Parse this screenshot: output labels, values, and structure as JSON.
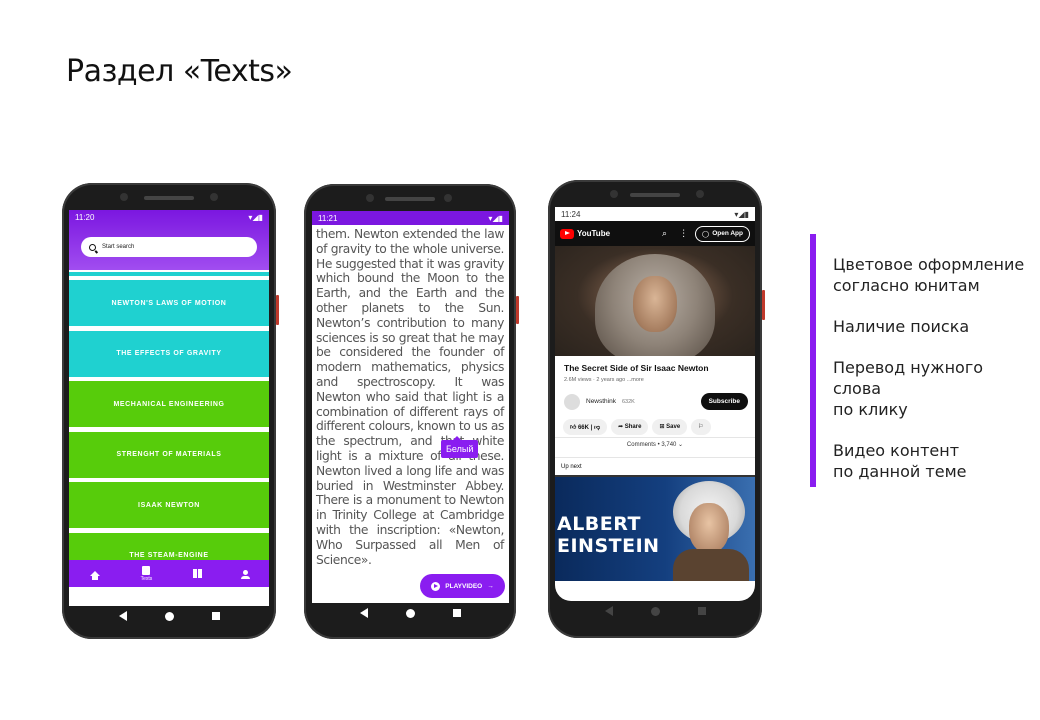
{
  "slide": {
    "title": "Раздел «Texts»"
  },
  "phone1": {
    "status_time": "11:20",
    "search_placeholder": "Start search",
    "topics": [
      {
        "label": "NEWTON'S LAWS OF MOTION",
        "color": "#1fd1d0"
      },
      {
        "label": "THE EFFECTS OF GRAVITY",
        "color": "#1fd1d0"
      },
      {
        "label": "MECHANICAL ENGINEERING",
        "color": "#57cc0b"
      },
      {
        "label": "STRENGHT OF MATERIALS",
        "color": "#57cc0b"
      },
      {
        "label": "ISAAK NEWTON",
        "color": "#57cc0b"
      },
      {
        "label": "THE STEAM-ENGINE",
        "color": "#57cc0b"
      }
    ],
    "bottom_nav": {
      "texts_label": "Texts"
    },
    "accent": "#8a1df0"
  },
  "phone2": {
    "status_time": "11:21",
    "reading_text": "them. Newton extended the law of gravity to the whole universe. He suggested that it was gravity which bound the Moon to the Earth, and the Earth and the other planets to the Sun. Newton’s contribution to many sciences is so great that he may be considered the founder of modern mathematics, physics and spectroscopy. It was Newton who said that light is a combination of different rays of different colours, known to us as the spectrum, and that white light is a mixture of all these. Newton lived a long life and was buried in Westminster Abbey. There is a monument to Newton in Trinity College at Cambridge with the inscription: «Newton, Who Surpassed all Men of Science».",
    "tooltip": "Белый",
    "play_button": "PLAYVIDEO"
  },
  "phone3": {
    "status_time": "11:24",
    "brand": "YouTube",
    "open_app": "Open App",
    "video_title": "The Secret Side of Sir Isaac Newton",
    "video_meta": "2.6M views · 2 years ago  ...more",
    "channel_name": "Newsthink",
    "channel_subs": "632K",
    "subscribe": "Subscribe",
    "actions": {
      "likes": "66K",
      "share": "Share",
      "save": "Save"
    },
    "comments": "Comments • 3,740",
    "up_next": "Up next",
    "next_thumb_text": "ALBERT\nEINSTEIN"
  },
  "features": [
    "Цветовое оформление\nсогласно юнитам",
    "Наличие поиска",
    "Перевод нужного слова\nпо клику",
    "Видео контент\nпо данной теме"
  ]
}
